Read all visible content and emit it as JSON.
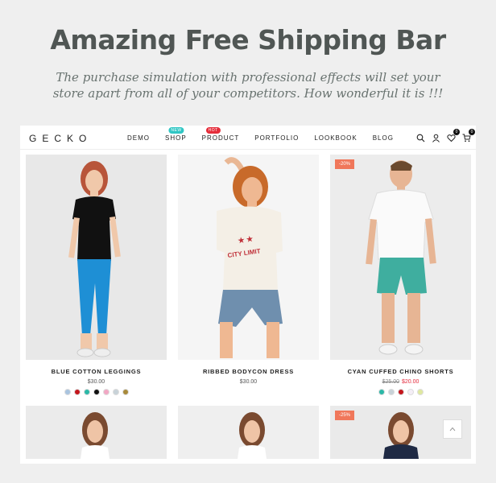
{
  "hero": {
    "title": "Amazing Free Shipping Bar",
    "subtitle": "The purchase simulation with professional effects will set your store apart from all of your competitors. How wonderful it is !!!"
  },
  "nav": {
    "logo": "GECKO",
    "menu": [
      {
        "label": "DEMO"
      },
      {
        "label": "SHOP",
        "badge": "NEW"
      },
      {
        "label": "PRODUCT",
        "badge": "HOT"
      },
      {
        "label": "PORTFOLIO"
      },
      {
        "label": "LOOKBOOK"
      },
      {
        "label": "BLOG"
      }
    ],
    "wishlist_count": "0",
    "cart_count": "0"
  },
  "products": [
    {
      "name": "BLUE COTTON LEGGINGS",
      "price": "$30.00",
      "swatches": [
        "#a9c4df",
        "#c4161c",
        "#2bb8a7",
        "#111111",
        "#f2a7c4",
        "#c8d2d8",
        "#a88a3a"
      ]
    },
    {
      "name": "RIBBED BODYCON DRESS",
      "price": "$30.00"
    },
    {
      "name": "CYAN CUFFED CHINO SHORTS",
      "old_price": "$25.00",
      "price": "$20.00",
      "sale": "-20%",
      "swatches": [
        "#2bb8a7",
        "#c8d2d8",
        "#c4161c",
        "#f4eef6",
        "#dfe8a0"
      ]
    }
  ],
  "second_row": [
    {
      "sale": ""
    },
    {
      "sale": ""
    },
    {
      "sale": "-25%"
    }
  ]
}
